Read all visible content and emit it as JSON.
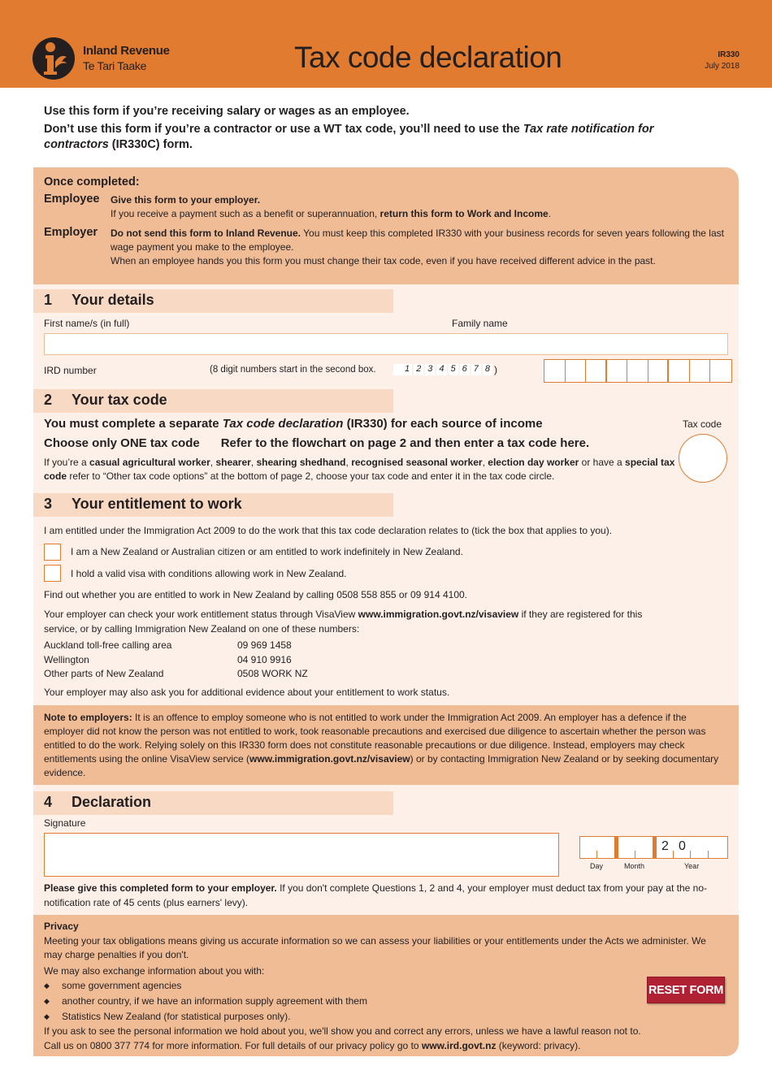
{
  "header": {
    "brand_line1": "Inland Revenue",
    "brand_line2": "Te Tari Taake",
    "title": "Tax code declaration",
    "form_id": "IR330",
    "form_date": "July 2018"
  },
  "intro": {
    "line1": "Use this form if you’re receiving salary or wages as an employee.",
    "line2_pre": "Don’t use this form if you’re a contractor or use a WT tax code, you’ll need to use the ",
    "line2_italic": "Tax rate notification for contractors",
    "line2_post": " (IR330C) form."
  },
  "once_completed": {
    "heading": "Once completed:",
    "employee_label": "Employee",
    "employee_bold": "Give this form to your employer.",
    "employee_text_pre": "If you receive a payment such as a benefit or superannuation, ",
    "employee_text_bold": "return this form to Work and Income",
    "employee_text_post": ".",
    "employer_label": "Employer",
    "employer_bold": "Do not send this form to Inland Revenue.",
    "employer_text": " You must keep this completed IR330 with your business records for seven years following the last wage payment you make to the employee.",
    "employer_text2": "When an employee hands you this form you must change their tax code, even if you have received different advice in the past."
  },
  "section1": {
    "number": "1",
    "title": "Your details",
    "first_name_label": "First name/s (in full)",
    "family_name_label": "Family name",
    "name_value": "",
    "ird_label": "IRD number",
    "ird_hint": "(8 digit numbers start in the second box.",
    "ird_example": [
      "1",
      "2",
      "3",
      "4",
      "5",
      "6",
      "7",
      "8"
    ],
    "ird_hint_close": ")",
    "ird_digits": [
      "",
      "",
      "",
      "",
      "",
      "",
      "",
      "",
      ""
    ]
  },
  "section2": {
    "number": "2",
    "title": "Your tax code",
    "line1_pre": "You must complete a separate ",
    "line1_italic": "Tax code declaration",
    "line1_post": " (IR330) for each source of income",
    "line2a": "Choose only ONE tax code",
    "line2b": "Refer to the flowchart on page 2 and then enter a tax code here.",
    "line3": {
      "t1": "If you’re a ",
      "b1": "casual agricultural worker",
      "t2": ", ",
      "b2": "shearer",
      "t3": ", ",
      "b3": "shearing shedhand",
      "t4": ", ",
      "b4": "recognised seasonal worker",
      "t5": ", ",
      "b5": "election day worker",
      "t6": " or have a ",
      "b6": "special tax code",
      "t7": " refer to “Other tax code options” at the bottom of page 2, choose your tax code and enter it in the tax code circle."
    },
    "tax_code_label": "Tax code",
    "tax_code_value": ""
  },
  "section3": {
    "number": "3",
    "title": "Your entitlement to work",
    "intro": "I am entitled under the Immigration Act 2009 to do the work that this tax code declaration relates to (tick the box that applies to you).",
    "option1": "I am a New Zealand or Australian citizen or am entitled to work indefinitely in New Zealand.",
    "option2": "I hold a valid visa with conditions allowing work in New Zealand.",
    "option1_checked": false,
    "option2_checked": false,
    "findout": "Find out whether you are entitled to work in New Zealand by calling 0508 558 855 or 09 914 4100.",
    "visaview_pre": "Your employer can check your work entitlement status through VisaView ",
    "visaview_link": "www.immigration.govt.nz/visaview",
    "visaview_post": " if they are registered for this",
    "visaview_line2": "service, or by calling Immigration New Zealand on one of these numbers:",
    "phones": [
      {
        "place": "Auckland toll-free calling area",
        "number": "09 969 1458"
      },
      {
        "place": "Wellington",
        "number": "04 910 9916"
      },
      {
        "place": "Other parts of New Zealand",
        "number": "0508 WORK NZ"
      }
    ],
    "evidence": "Your employer may also ask you for additional evidence about your entitlement to work status."
  },
  "note_to_employers": {
    "label": "Note to employers:",
    "text": " It is an offence to employ someone who is not entitled to work under the Immigration Act 2009. An employer has a defence if the employer did not know the person was not entitled to work, took reasonable precautions and exercised due diligence to ascertain whether the person was entitled to do the work. Relying solely on this IR330 form does not constitute reasonable precautions or due diligence. Instead, employers may check entitlements using the online VisaView service (",
    "link": "www.immigration.govt.nz/visaview",
    "text2": ") or by contacting Immigration New Zealand or by seeking documentary evidence."
  },
  "section4": {
    "number": "4",
    "title": "Declaration",
    "signature_label": "Signature",
    "date_year_prefix": [
      "2",
      "0"
    ],
    "day_label": "Day",
    "month_label": "Month",
    "year_label": "Year",
    "note_bold": "Please give this completed form to your employer.",
    "note_text": " If you don't complete Questions 1, 2 and 4, your employer must deduct tax from your pay at the no-notification rate of 45 cents (plus earners' levy)."
  },
  "privacy": {
    "heading": "Privacy",
    "p1": "Meeting your tax obligations means giving us accurate information so we can assess your liabilities or your entitlements under the Acts we administer. We may charge penalties if you don't.",
    "p2": "We may also exchange information about you with:",
    "bullets": [
      "some government agencies",
      "another country, if we have an information supply agreement with them",
      "Statistics New Zealand (for statistical purposes only)."
    ],
    "p3": "If you ask to see the personal information we hold about you, we'll show you and correct any errors, unless we have a lawful reason not to.",
    "p4_pre": "Call us on 0800 377 774 for more information. For full details of our privacy policy go to ",
    "p4_link": "www.ird.govt.nz",
    "p4_post": " (keyword: privacy).",
    "reset_label": "RESET FORM"
  },
  "colors": {
    "brand_orange": "#e07b30",
    "panel_dark": "#f0bc96",
    "panel_light": "#fcf0e8",
    "section_head": "#f7d9c4",
    "reset_red": "#b02233"
  }
}
